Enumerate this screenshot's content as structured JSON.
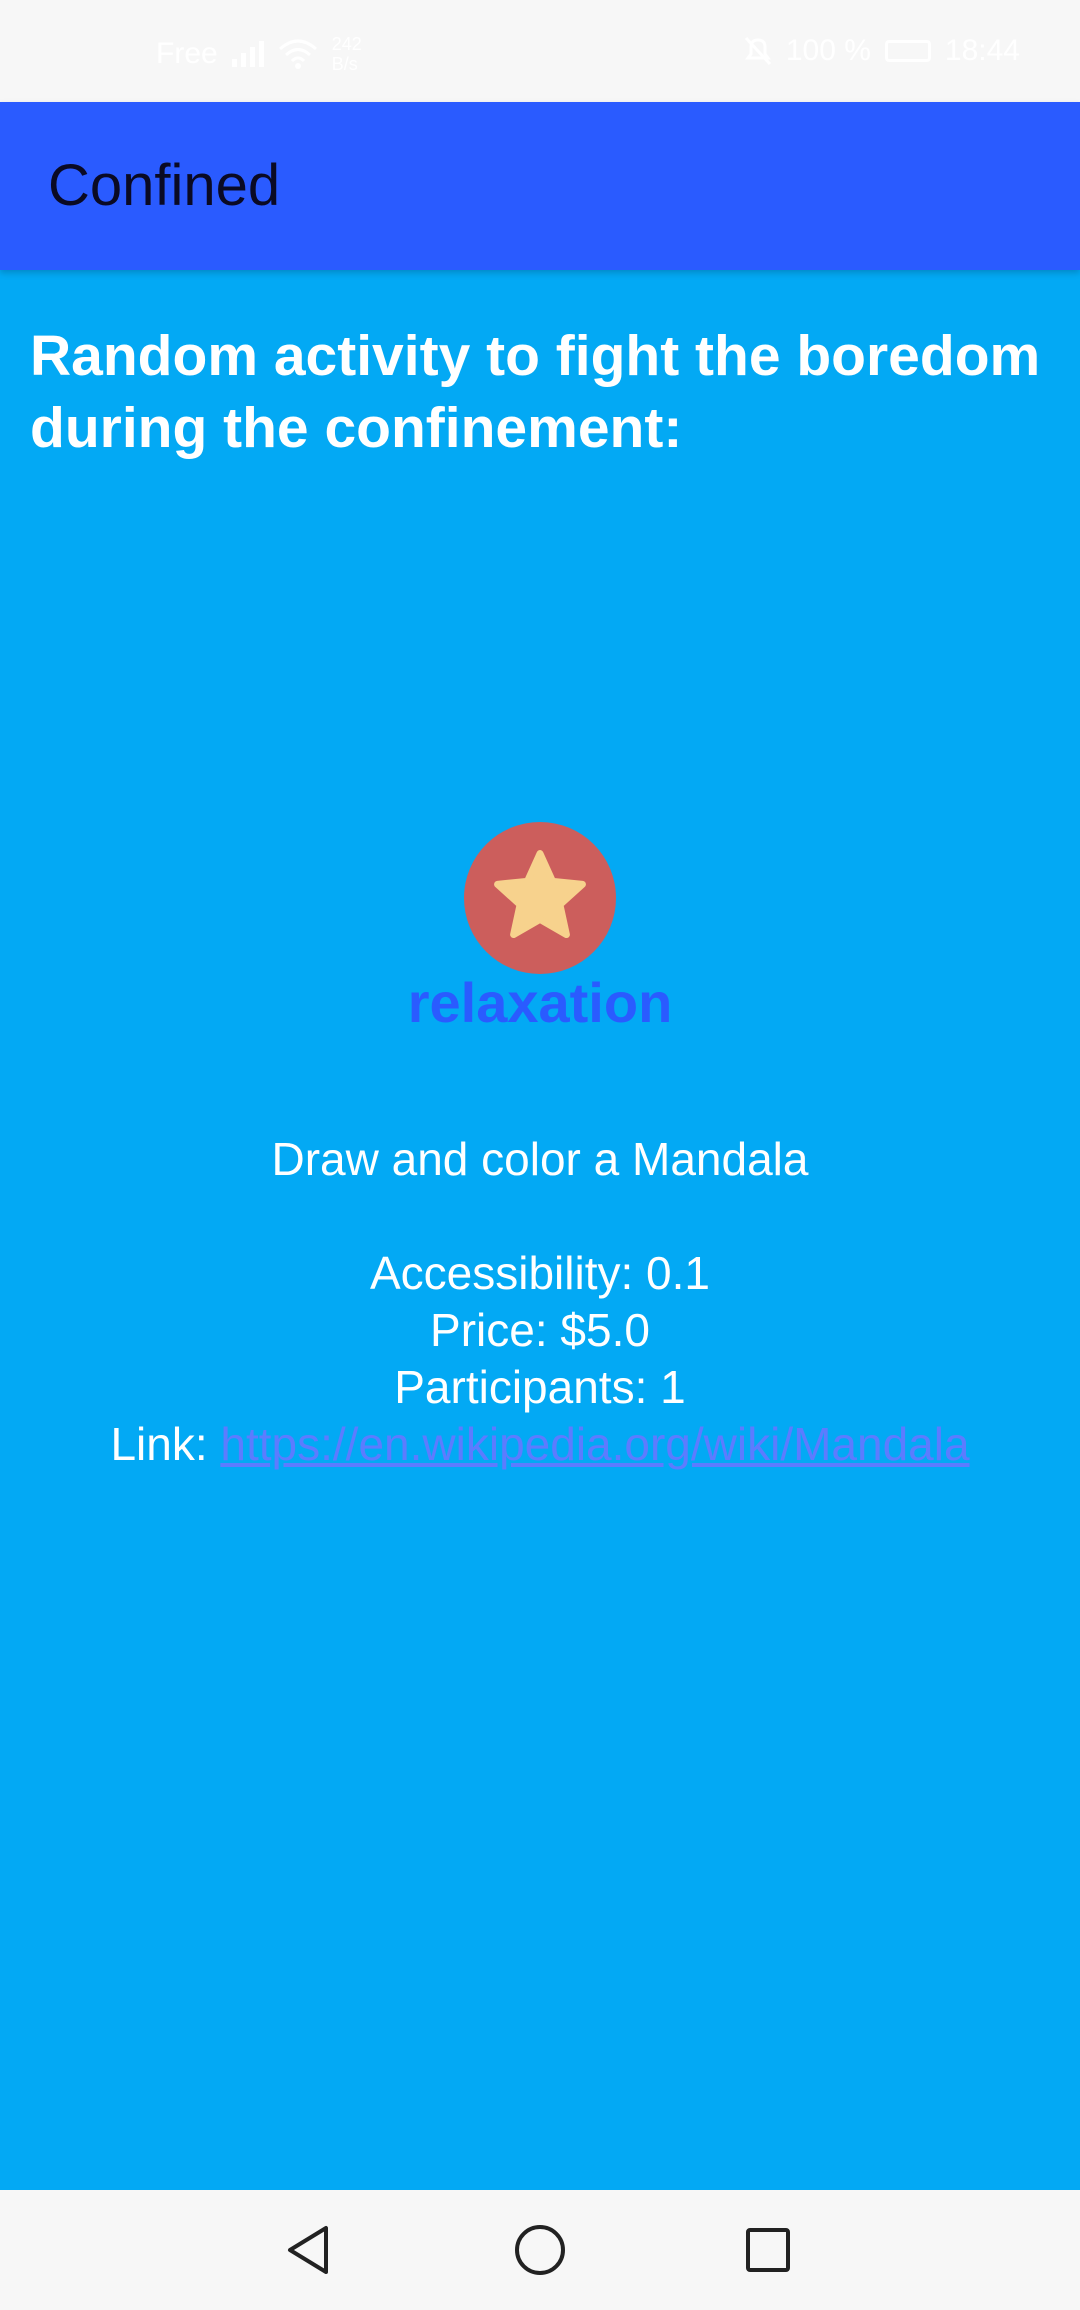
{
  "status_bar": {
    "carrier": "Free",
    "net_speed_value": "242",
    "net_speed_unit": "B/s",
    "battery_percent": "100 %",
    "time": "18:44"
  },
  "app_bar": {
    "title": "Confined"
  },
  "main": {
    "heading": "Random activity to fight the boredom during the confinement:",
    "category_icon": "star-icon",
    "category": "relaxation",
    "activity": "Draw and color a Mandala",
    "accessibility_label": "Accessibility: 0.1",
    "price_label": "Price: $5.0",
    "participants_label": "Participants: 1",
    "link_prefix": "Link: ",
    "link_url": "https://en.wikipedia.org/wiki/Mandala"
  },
  "nav_bar": {
    "back_icon": "back-triangle-icon",
    "home_icon": "home-circle-icon",
    "recents_icon": "recents-square-icon"
  },
  "colors": {
    "background": "#03A9F4",
    "app_bar": "#2A5BFF",
    "category_text": "#2A5BFF",
    "badge": "#CC5E5C",
    "star": "#F7D28D",
    "link": "#5C7CFF"
  }
}
